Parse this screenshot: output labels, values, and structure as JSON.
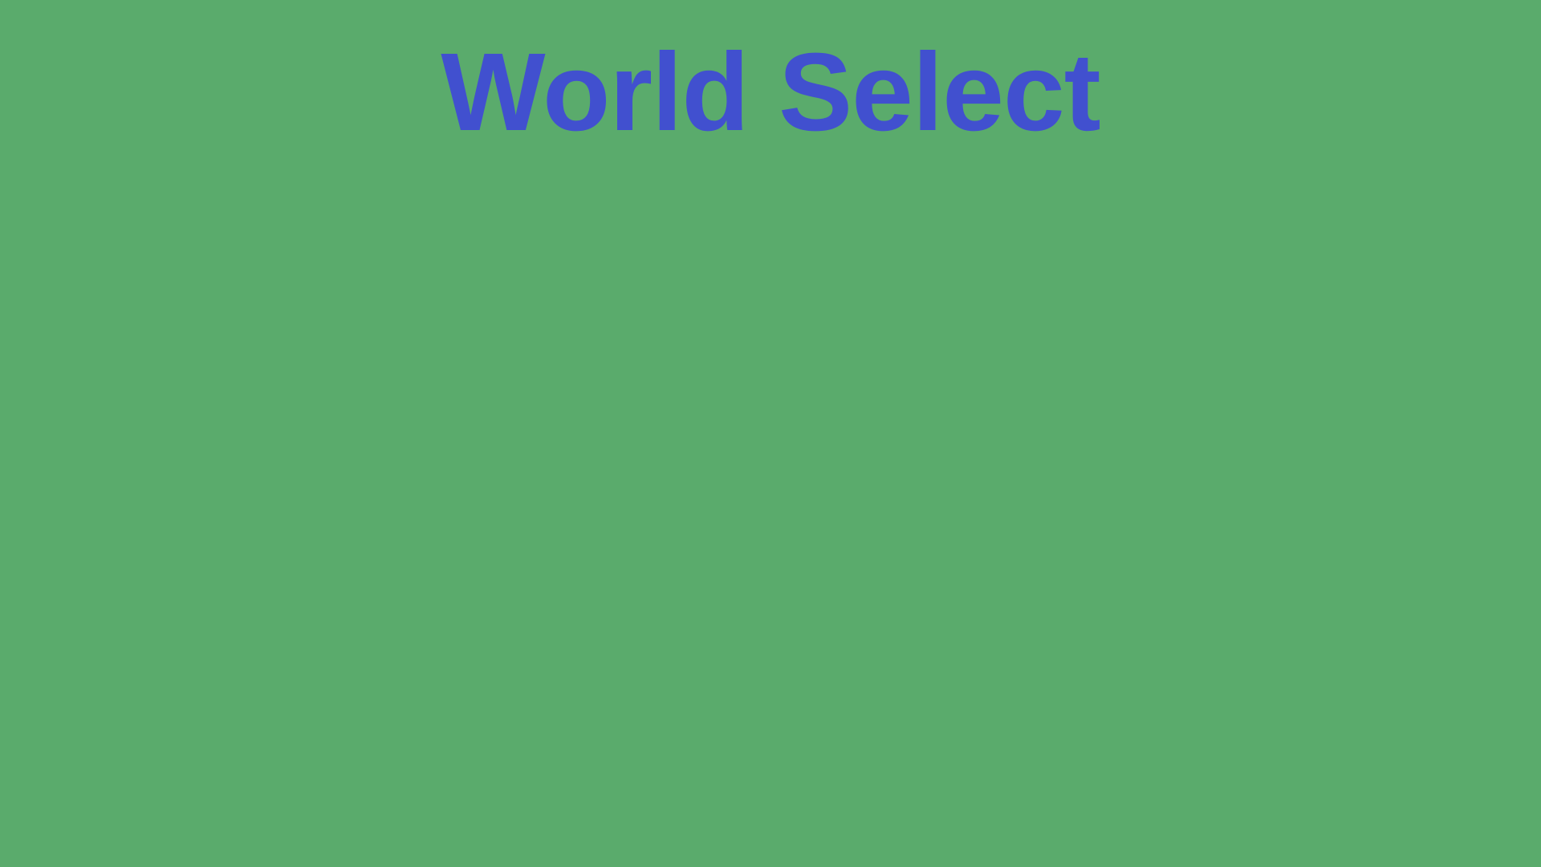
{
  "screen": {
    "title": "World Select",
    "background_color": "#5aab6c",
    "title_color": "#4150cf"
  }
}
